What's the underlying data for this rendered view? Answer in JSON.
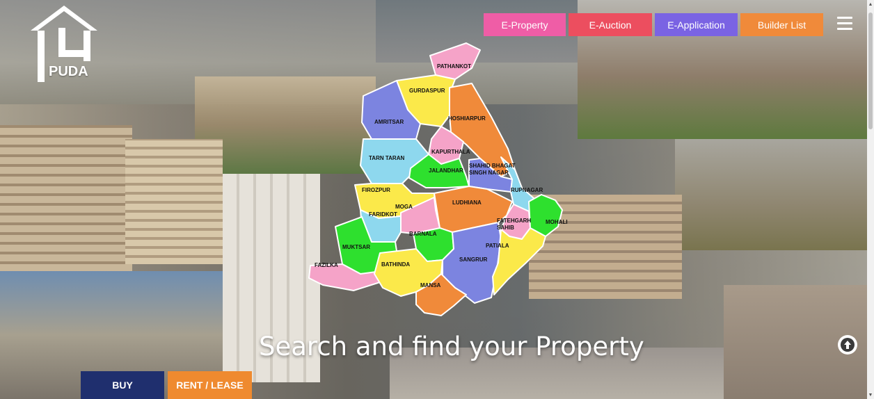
{
  "brand": {
    "name": "PUDA"
  },
  "nav": {
    "e_property": "E-Property",
    "e_auction": "E-Auction",
    "e_application": "E-Application",
    "builder_list": "Builder List"
  },
  "map": {
    "districts": [
      {
        "name": "PATHANKOT",
        "color": "#f5a3c8"
      },
      {
        "name": "GURDASPUR",
        "color": "#fbe94a"
      },
      {
        "name": "AMRITSAR",
        "color": "#7c84e0"
      },
      {
        "name": "HOSHIARPUR",
        "color": "#f08a3a"
      },
      {
        "name": "KAPURTHALA",
        "color": "#f5a3c8"
      },
      {
        "name": "TARN TARAN",
        "color": "#8ed8ee"
      },
      {
        "name": "JALANDHAR",
        "color": "#2ee02e"
      },
      {
        "name": "SHAHID BHAGAT SINGH NAGAR",
        "color": "#7c84e0"
      },
      {
        "name": "RUPNAGAR",
        "color": "#8ed8ee"
      },
      {
        "name": "FIROZPUR",
        "color": "#fbe94a"
      },
      {
        "name": "FARIDKOT",
        "color": "#8ed8ee"
      },
      {
        "name": "MOGA",
        "color": "#f5a3c8"
      },
      {
        "name": "LUDHIANA",
        "color": "#f08a3a"
      },
      {
        "name": "FATEHGARH SAHIB",
        "color": "#f5a3c8"
      },
      {
        "name": "MOHALI",
        "color": "#2ee02e"
      },
      {
        "name": "MUKTSAR",
        "color": "#2ee02e"
      },
      {
        "name": "BARNALA",
        "color": "#2ee02e"
      },
      {
        "name": "FAZILKA",
        "color": "#f5a3c8"
      },
      {
        "name": "BATHINDA",
        "color": "#fbe94a"
      },
      {
        "name": "SANGRUR",
        "color": "#7c84e0"
      },
      {
        "name": "PATIALA",
        "color": "#fbe94a"
      },
      {
        "name": "MANSA",
        "color": "#f08a3a"
      }
    ]
  },
  "hero": {
    "title": "Search and find your Property"
  },
  "tabs": {
    "buy": "BUY",
    "rent_lease": "RENT / LEASE"
  },
  "icons": {
    "menu": "hamburger-icon",
    "scroll_top": "arrow-up-circle-icon"
  }
}
